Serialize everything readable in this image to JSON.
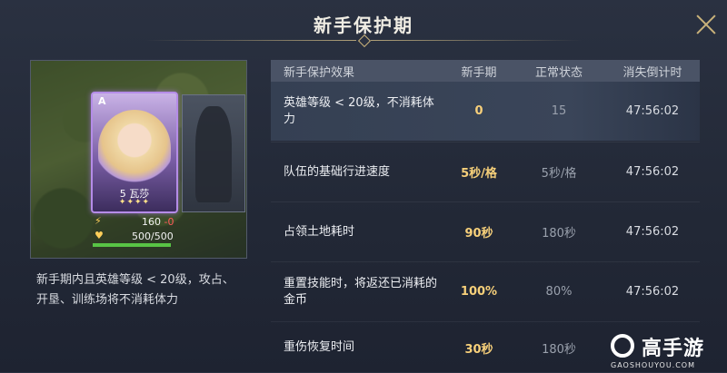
{
  "header": {
    "title": "新手保护期"
  },
  "left_panel": {
    "hero_card": {
      "rank": "A",
      "level_name": "5 瓦莎",
      "stars": "✦✦✦✦"
    },
    "stats": {
      "energy_value": "160",
      "energy_change": "-0",
      "hp": "500/500",
      "hp_progress": 1.0
    },
    "description": "新手期内且英雄等级 < 20级，攻占、开垦、训练场将不消耗体力"
  },
  "table": {
    "headers": [
      "新手保护效果",
      "新手期",
      "正常状态",
      "消失倒计时"
    ],
    "rows": [
      {
        "effect": "英雄等级 < 20级，不消耗体力",
        "newbie": "0",
        "normal": "15",
        "countdown": "47:56:02"
      },
      {
        "effect": "队伍的基础行进速度",
        "newbie": "5秒/格",
        "normal": "5秒/格",
        "countdown": "47:56:02"
      },
      {
        "effect": "占领土地耗时",
        "newbie": "90秒",
        "normal": "180秒",
        "countdown": "47:56:02"
      },
      {
        "effect": "重置技能时，将返还已消耗的金币",
        "newbie": "100%",
        "normal": "80%",
        "countdown": "47:56:02"
      },
      {
        "effect": "重伤恢复时间",
        "newbie": "30秒",
        "normal": "180秒",
        "countdown": ""
      }
    ]
  },
  "watermark": {
    "name": "高手游",
    "url": "GAOSHOUYOU.COM"
  },
  "colors": {
    "highlight": "#f7d07a",
    "accent_gold": "#c9b27a",
    "card_purple": "#b58ce8",
    "hp_green": "#58c445"
  }
}
